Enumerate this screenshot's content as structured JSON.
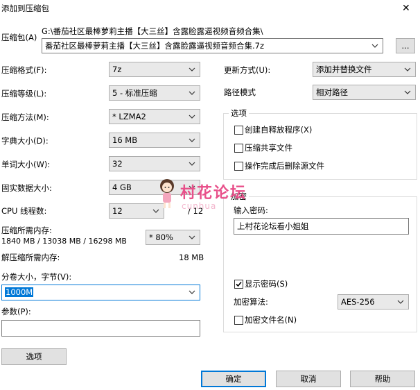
{
  "window": {
    "title": "添加到压缩包",
    "close_glyph": "✕"
  },
  "archive": {
    "label": "压缩包(A)",
    "path": "G:\\番茄社区最棒萝莉主播【大三丝】含露脸露逼视频音频合集\\",
    "name_value": "番茄社区最棒萝莉主播【大三丝】含露脸露逼视频音频合集.7z",
    "browse_label": "..."
  },
  "left": {
    "format": {
      "label": "压缩格式(F):",
      "value": "7z"
    },
    "level": {
      "label": "压缩等级(L):",
      "value": "5 - 标准压缩"
    },
    "method": {
      "label": "压缩方法(M):",
      "value": "*  LZMA2"
    },
    "dict": {
      "label": "字典大小(D):",
      "value": "16 MB"
    },
    "word": {
      "label": "单词大小(W):",
      "value": "32"
    },
    "solid": {
      "label": "固实数据大小:",
      "value": "4 GB"
    },
    "cpu": {
      "label": "CPU 线程数:",
      "value": "12",
      "total": "/ 12"
    },
    "mem_compress": {
      "label": "压缩所需内存:",
      "detail": "1840 MB / 13038 MB / 16298 MB",
      "percent": "* 80%"
    },
    "mem_decompress": {
      "label": "解压缩所需内存:",
      "value": "18 MB"
    },
    "split": {
      "label": "分卷大小，字节(V):",
      "value": "1000M"
    },
    "params": {
      "label": "参数(P):",
      "value": ""
    },
    "options_button": "选项"
  },
  "right": {
    "update": {
      "label": "更新方式(U):",
      "value": "添加并替换文件"
    },
    "path_mode": {
      "label": "路径模式",
      "value": "相对路径"
    },
    "options_group": {
      "title": "选项",
      "sfx": {
        "label": "创建自释放程序(X)",
        "checked": false
      },
      "shared": {
        "label": "压缩共享文件",
        "checked": false
      },
      "delete": {
        "label": "操作完成后删除源文件",
        "checked": false
      }
    },
    "encryption_group": {
      "title": "加密",
      "password_label": "输入密码:",
      "password_value": "上村花论坛看小姐姐",
      "show_password": {
        "label": "显示密码(S)",
        "checked": true
      },
      "method_label": "加密算法:",
      "method_value": "AES-256",
      "encrypt_names": {
        "label": "加密文件名(N)",
        "checked": false
      }
    }
  },
  "buttons": {
    "ok": "确定",
    "cancel": "取消",
    "help": "帮助"
  },
  "watermark": {
    "text": "村花论坛",
    "sub": "cunhua"
  }
}
